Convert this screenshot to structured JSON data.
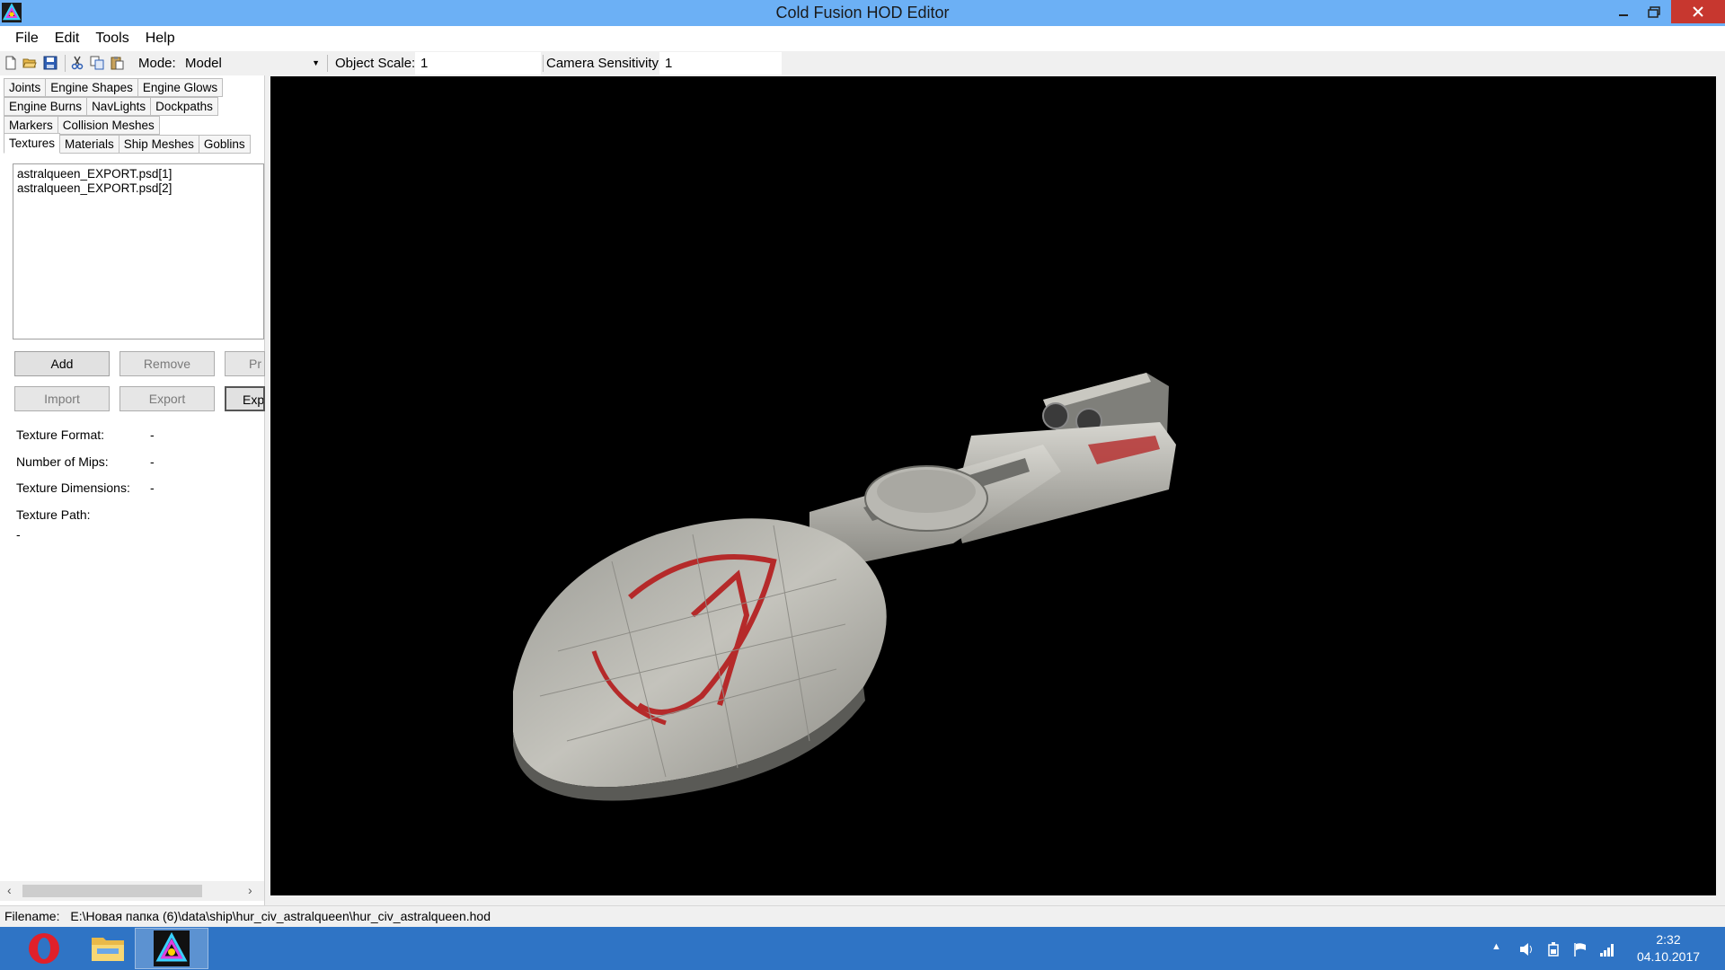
{
  "window": {
    "title": "Cold Fusion HOD Editor"
  },
  "menu": [
    "File",
    "Edit",
    "Tools",
    "Help"
  ],
  "toolbar": {
    "mode_label": "Mode:",
    "mode_value": "Model",
    "scale_label": "Object Scale:",
    "scale_value": "1",
    "sensitivity_label": "Camera Sensitivity:",
    "sensitivity_value": "1"
  },
  "tabs": {
    "row1": [
      "Joints",
      "Engine Shapes",
      "Engine Glows"
    ],
    "row2": [
      "Engine Burns",
      "NavLights",
      "Dockpaths"
    ],
    "row3": [
      "Markers",
      "Collision Meshes"
    ],
    "row4": [
      "Textures",
      "Materials",
      "Ship Meshes",
      "Goblins"
    ],
    "active": "Textures"
  },
  "textures": {
    "items": [
      "astralqueen_EXPORT.psd[1]",
      "astralqueen_EXPORT.psd[2]"
    ],
    "buttons": {
      "add": "Add",
      "remove": "Remove",
      "preview_partial": "Pr",
      "import": "Import",
      "export": "Export",
      "export_partial": "Exp"
    },
    "info": {
      "format_label": "Texture Format:",
      "format_value": "-",
      "mips_label": "Number of Mips:",
      "mips_value": "-",
      "dimensions_label": "Texture Dimensions:",
      "dimensions_value": "-",
      "path_label": "Texture Path:",
      "path_value": "-"
    }
  },
  "status": {
    "filename_label": "Filename:",
    "filename_value": "E:\\Новая папка (6)\\data\\ship\\hur_civ_astralqueen\\hur_civ_astralqueen.hod"
  },
  "taskbar": {
    "apps": [
      "opera-icon",
      "file-explorer-icon",
      "cold-fusion-icon"
    ],
    "time": "2:32",
    "date": "04.10.2017"
  },
  "colors": {
    "titlebar": "#6cb0f5",
    "taskbar": "#2f74c5",
    "close_button": "#c7372f",
    "viewport_bg": "#000000",
    "hull_marking": "#b52a2a"
  }
}
